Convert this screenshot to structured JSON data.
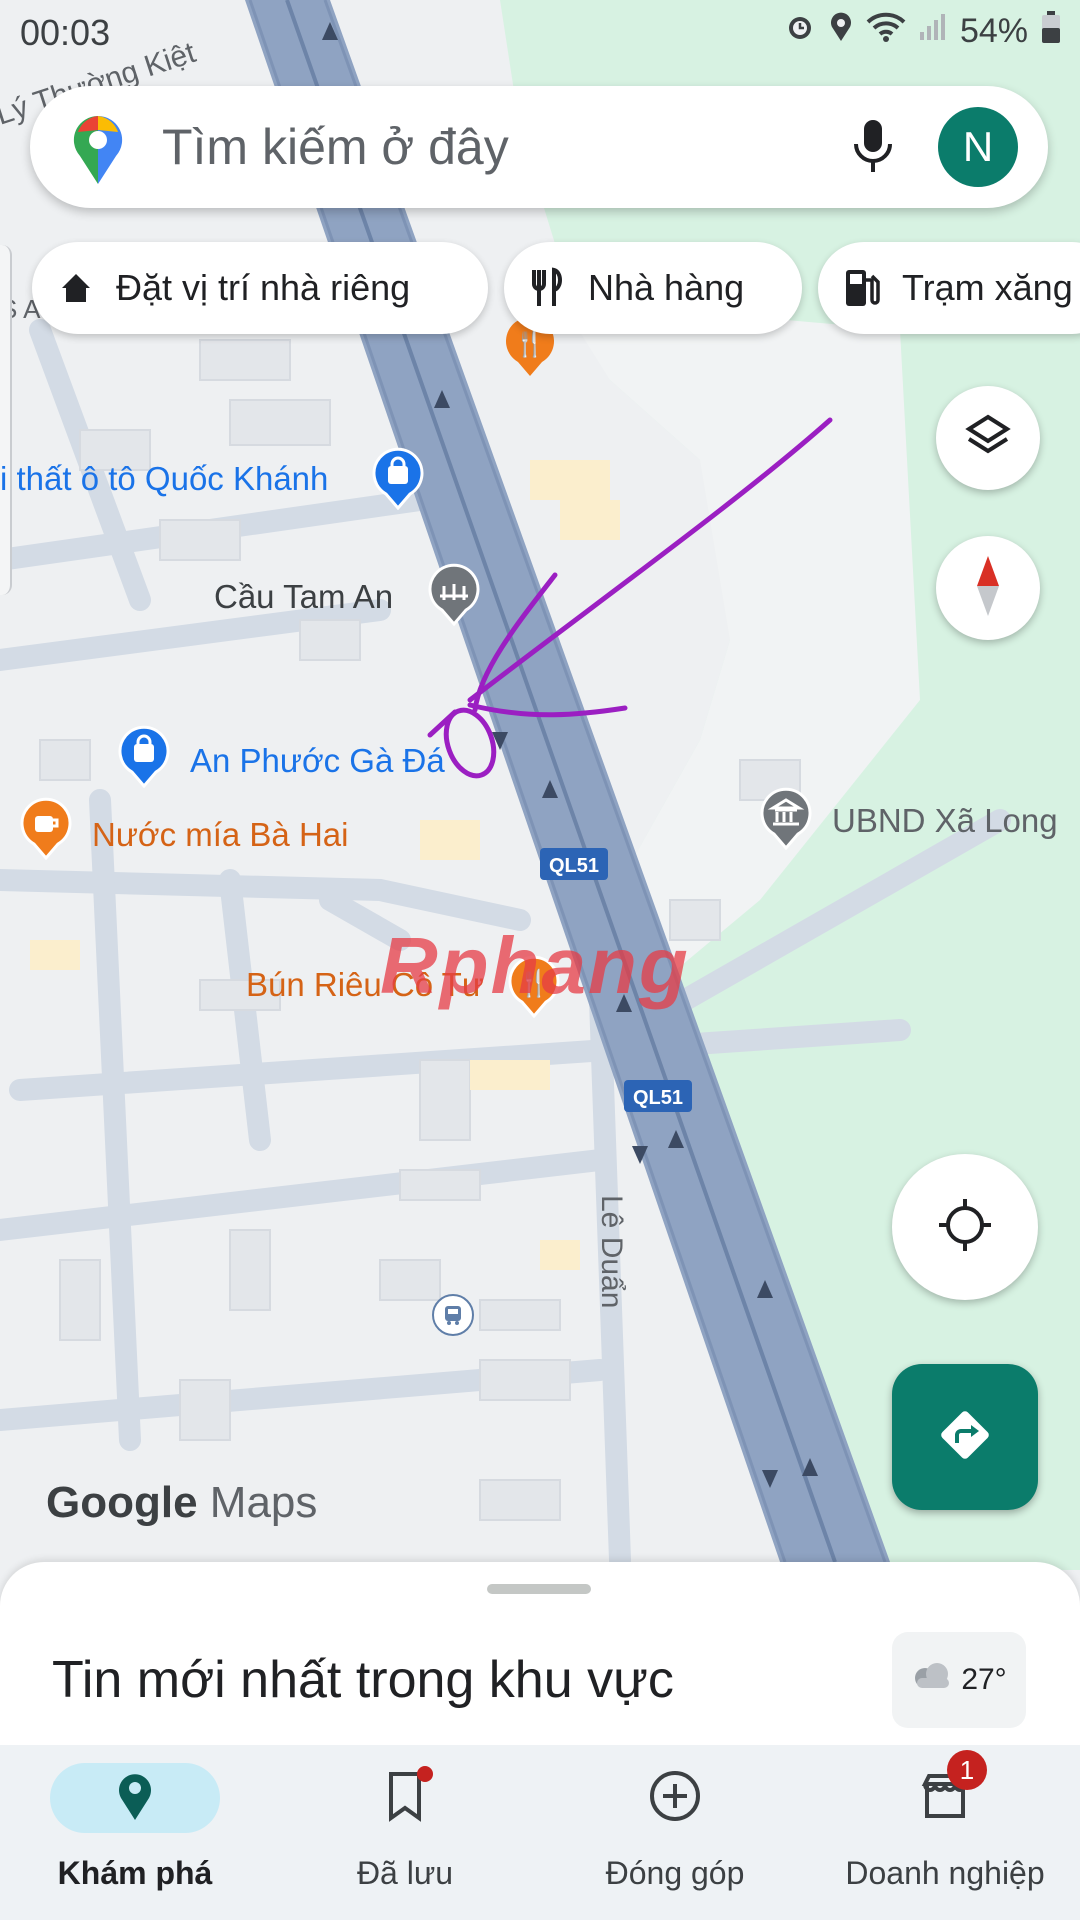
{
  "status_bar": {
    "time": "00:03",
    "battery": "54%"
  },
  "search": {
    "placeholder": "Tìm kiếm ở đây",
    "avatar_letter": "N"
  },
  "chips": [
    {
      "label": "Đặt vị trí nhà riêng",
      "icon": "home-icon"
    },
    {
      "label": "Nhà hàng",
      "icon": "restaurant-icon"
    },
    {
      "label": "Trạm xăng",
      "icon": "gas-station-icon"
    }
  ],
  "map": {
    "street_labels": {
      "top_left": "Lý Thường Kiệt",
      "vertical": "Lê Duẩn",
      "left_edge": "S A"
    },
    "road_shields": [
      "QL51",
      "QL51"
    ],
    "places": {
      "shop1": "i thất ô tô Quốc Khánh",
      "bridge": "Cầu Tam An",
      "shop2": "An Phước Gà Đá",
      "cafe": "Nước mía Bà Hai",
      "government": "UBND Xã Long",
      "restaurant": "Bún Riêu Cô Tư"
    },
    "watermark": "Rphang",
    "branding": {
      "google": "Google",
      "maps": "Maps"
    }
  },
  "sheet": {
    "title": "Tin mới nhất trong khu vực",
    "temperature": "27°"
  },
  "nav": [
    {
      "label": "Khám phá",
      "icon": "explore-pin-icon",
      "active": true
    },
    {
      "label": "Đã lưu",
      "icon": "bookmark-icon"
    },
    {
      "label": "Đóng góp",
      "icon": "add-circle-icon"
    },
    {
      "label": "Doanh nghiệp",
      "icon": "business-icon",
      "badge": "1"
    }
  ],
  "colors": {
    "road": "#8fa3c2",
    "road_edge": "#6d84a8",
    "park": "#d7f2e2",
    "land": "#eef0f2",
    "street": "#cfd8e3",
    "accent_teal": "#0b7c6b",
    "poi_blue": "#1a73e8",
    "poi_orange": "#f07c1b",
    "annotation": "#9b1fc2"
  }
}
